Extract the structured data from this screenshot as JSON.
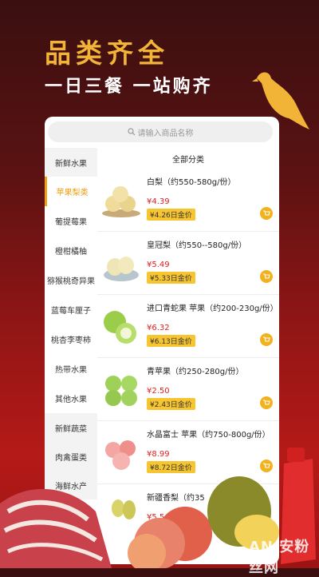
{
  "hero": {
    "title": "品类齐全",
    "subtitle": "一日三餐 一站购齐"
  },
  "search": {
    "placeholder": "请输入商品名称"
  },
  "sidebar": {
    "items": [
      {
        "label": "新鲜水果"
      },
      {
        "label": "苹果梨类",
        "active": true
      },
      {
        "label": "葡提莓果"
      },
      {
        "label": "橙柑橘柚"
      },
      {
        "label": "猕猴桃奇异果"
      },
      {
        "label": "蓝莓车厘子"
      },
      {
        "label": "桃杏李枣柿"
      },
      {
        "label": "热带水果"
      },
      {
        "label": "其他水果"
      },
      {
        "label": "新鲜蔬菜"
      },
      {
        "label": "肉禽蛋类"
      },
      {
        "label": "海鲜水产"
      }
    ]
  },
  "content": {
    "section_title": "全部分类",
    "products": [
      {
        "name": "白梨（约550-580g/份）",
        "price": "¥4.39",
        "member_price": "¥4.26日金价",
        "icon": "pear-icon"
      },
      {
        "name": "皇冠梨（约550--580g/份）",
        "price": "¥5.49",
        "member_price": "¥5.33日金价",
        "icon": "crown-pear-icon"
      },
      {
        "name": "进口青蛇果 苹果（约200-230g/份）",
        "price": "¥6.32",
        "member_price": "¥6.13日金价",
        "icon": "green-apple-icon"
      },
      {
        "name": "青苹果（约250-280g/份）",
        "price": "¥2.50",
        "member_price": "¥2.43日金价",
        "icon": "green-apple-icon"
      },
      {
        "name": "水晶富士 苹果（约750-800g/份）",
        "price": "¥8.99",
        "member_price": "¥8.72日金价",
        "icon": "fuji-apple-icon"
      },
      {
        "name": "新疆香梨（约35",
        "price": "¥5.5",
        "member_price": "",
        "icon": "fragrant-pear-icon"
      }
    ]
  },
  "watermark": {
    "text": "AN 安粉丝网"
  },
  "colors": {
    "accent": "#f0a010",
    "price": "#e02020",
    "member_bg": "#f7c530",
    "title": "#f2b437"
  }
}
